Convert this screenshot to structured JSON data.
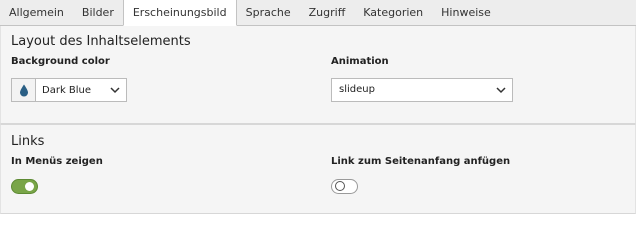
{
  "tabs": [
    {
      "label": "Allgemein",
      "active": false
    },
    {
      "label": "Bilder",
      "active": false
    },
    {
      "label": "Erscheinungsbild",
      "active": true
    },
    {
      "label": "Sprache",
      "active": false
    },
    {
      "label": "Zugriff",
      "active": false
    },
    {
      "label": "Kategorien",
      "active": false
    },
    {
      "label": "Hinweise",
      "active": false
    }
  ],
  "layout_section": {
    "title": "Layout des Inhaltselements",
    "background_color": {
      "label": "Background color",
      "value": "Dark Blue",
      "icon": "droplet-icon",
      "icon_color": "#2a5f85"
    },
    "animation": {
      "label": "Animation",
      "value": "slideup"
    }
  },
  "links_section": {
    "title": "Links",
    "show_in_menus": {
      "label": "In Menüs zeigen",
      "checked": true,
      "on_color": "#79a548"
    },
    "add_to_top_link": {
      "label": "Link zum Seitenanfang anfügen",
      "checked": false
    }
  }
}
